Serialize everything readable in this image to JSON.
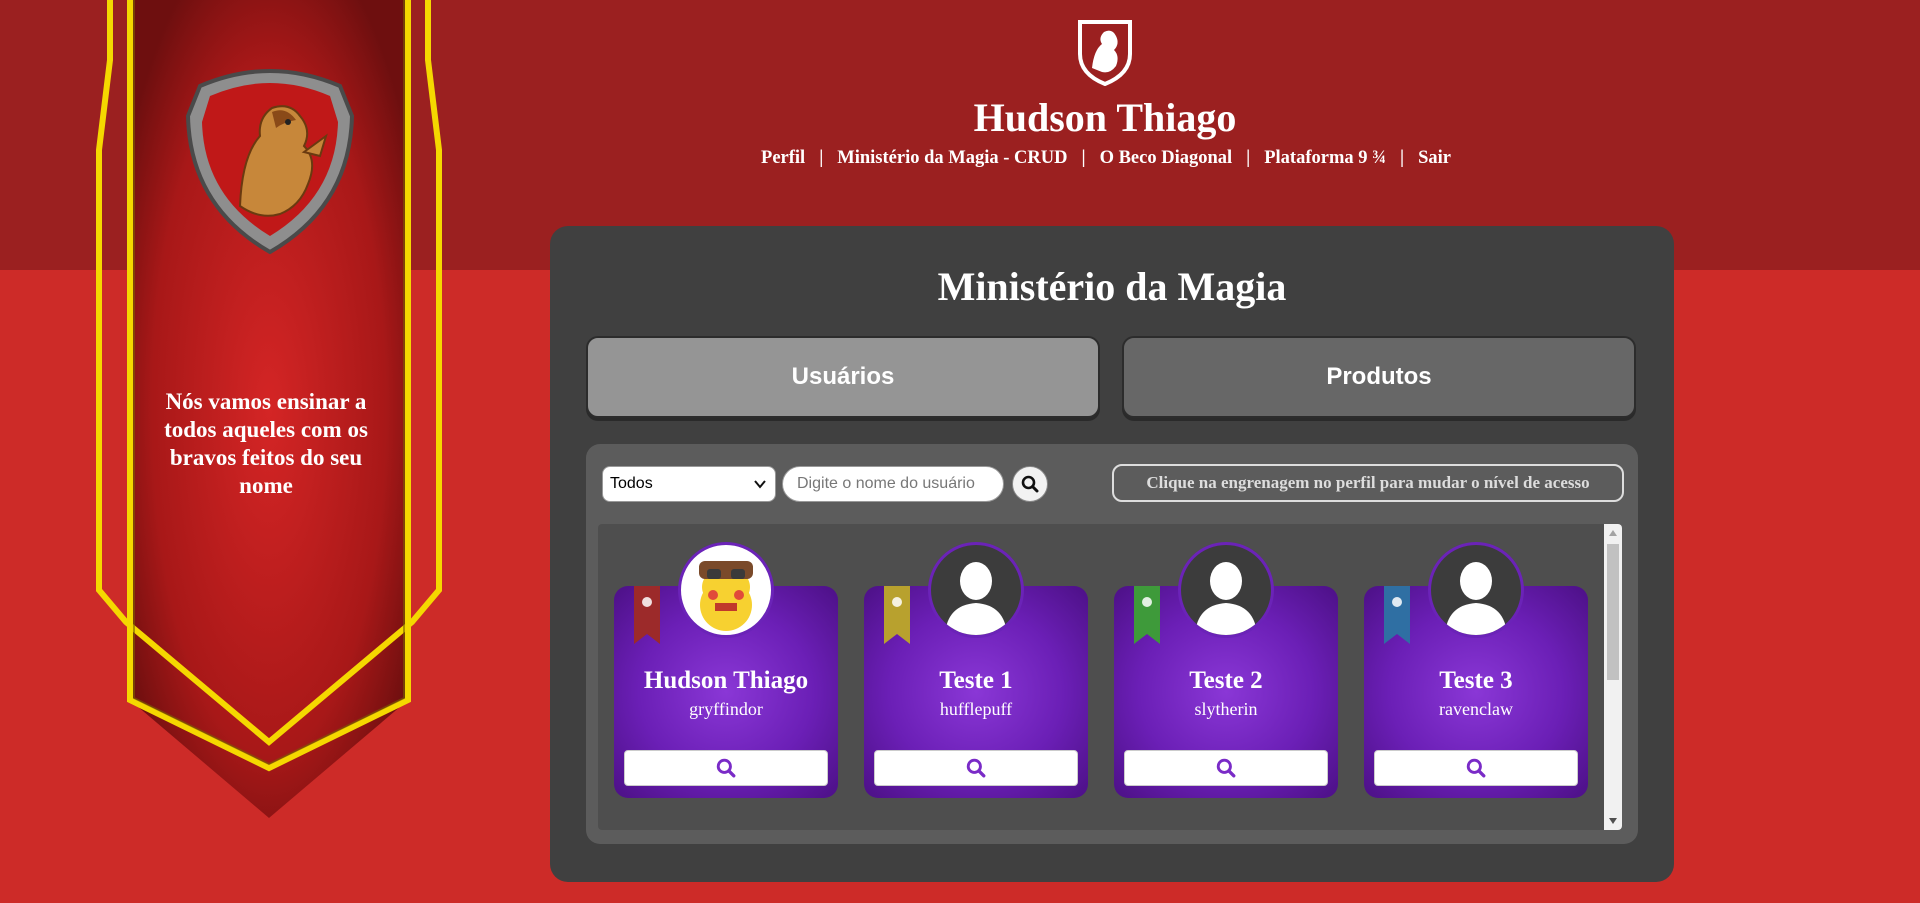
{
  "banner": {
    "motto": "Nós vamos ensinar a todos aqueles com os bravos feitos do seu nome"
  },
  "header": {
    "user_name": "Hudson Thiago",
    "nav": [
      {
        "label": "Perfil"
      },
      {
        "label": "Ministério da Magia - CRUD"
      },
      {
        "label": "O Beco Diagonal"
      },
      {
        "label": "Plataforma 9 ¾"
      },
      {
        "label": "Sair"
      }
    ],
    "separator": "|"
  },
  "panel": {
    "title": "Ministério da Magia",
    "tabs": [
      {
        "label": "Usuários",
        "active": true
      },
      {
        "label": "Produtos",
        "active": false
      }
    ],
    "filter": {
      "selected": "Todos"
    },
    "search": {
      "placeholder": "Digite o nome do usuário",
      "value": ""
    },
    "hint": "Clique na engrenagem no perfil para mudar o nível de acesso",
    "cards": [
      {
        "name": "Hudson Thiago",
        "house": "gryffindor",
        "ribbon_color": "#9c2a2a",
        "avatar": "pikachu"
      },
      {
        "name": "Teste 1",
        "house": "hufflepuff",
        "ribbon_color": "#b8a12e",
        "avatar": "default"
      },
      {
        "name": "Teste 2",
        "house": "slytherin",
        "ribbon_color": "#3e9a3a",
        "avatar": "default"
      },
      {
        "name": "Teste 3",
        "house": "ravenclaw",
        "ribbon_color": "#2f6fa3",
        "avatar": "default"
      }
    ]
  },
  "colors": {
    "header_bg": "#9b2020",
    "page_bg": "#cd2b28",
    "panel_bg": "#404040",
    "card_purple": "#6b1fb6",
    "accent_gold": "#f2d600"
  }
}
